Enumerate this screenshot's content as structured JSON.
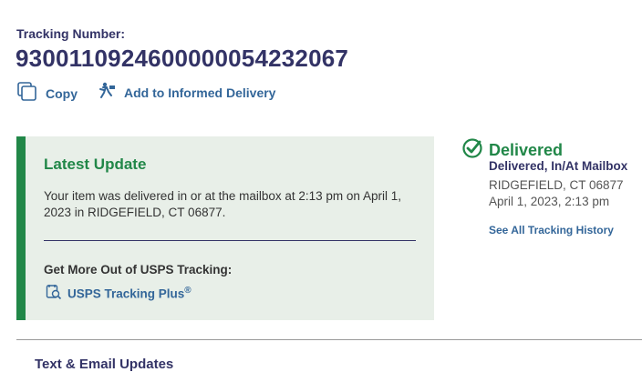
{
  "tracking": {
    "label": "Tracking Number:",
    "number": "9300110924600000054232067"
  },
  "actions": {
    "copy": "Copy",
    "informed": "Add to Informed Delivery"
  },
  "latest_update": {
    "title": "Latest Update",
    "body": "Your item was delivered in or at the mailbox at 2:13 pm on April 1, 2023 in RIDGEFIELD, CT 06877.",
    "more_label": "Get More Out of USPS Tracking:",
    "plus_label": "USPS Tracking Plus",
    "plus_reg": "®"
  },
  "status": {
    "title": "Delivered",
    "subtitle": "Delivered, In/At Mailbox",
    "location": "RIDGEFIELD, CT 06877",
    "datetime": "April 1, 2023, 2:13 pm",
    "history_link": "See All Tracking History"
  },
  "next_section": {
    "title": "Text & Email Updates"
  },
  "colors": {
    "navy": "#333366",
    "green": "#218748",
    "link": "#336699",
    "panel": "#e8efe8"
  }
}
